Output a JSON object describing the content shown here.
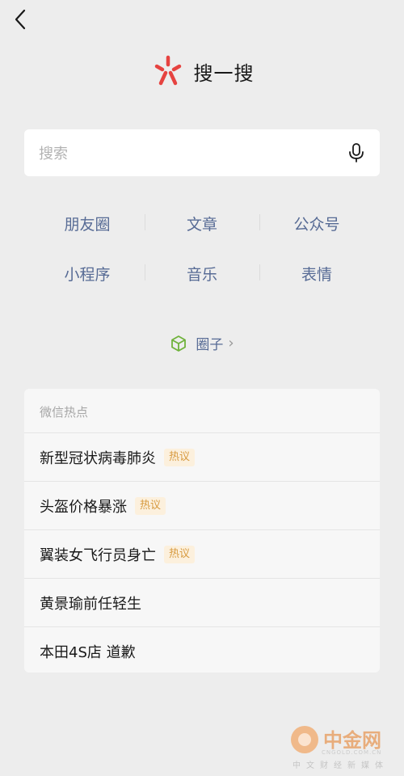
{
  "header": {
    "title": "搜一搜",
    "back_icon": "chevron-left-icon",
    "logo_icon": "search-spark-logo",
    "brand_color": "#e64340"
  },
  "search": {
    "placeholder": "搜索",
    "mic_icon": "microphone-icon"
  },
  "categories": [
    {
      "label": "朋友圈"
    },
    {
      "label": "文章"
    },
    {
      "label": "公众号"
    },
    {
      "label": "小程序"
    },
    {
      "label": "音乐"
    },
    {
      "label": "表情"
    }
  ],
  "circle": {
    "label": "圈子",
    "icon": "cube-icon",
    "chevron": "›"
  },
  "hot": {
    "title": "微信热点",
    "items": [
      {
        "text": "新型冠状病毒肺炎",
        "badge": "热议"
      },
      {
        "text": "头盔价格暴涨",
        "badge": "热议"
      },
      {
        "text": "翼装女飞行员身亡",
        "badge": "热议"
      },
      {
        "text": "黄景瑜前任轻生",
        "badge": ""
      },
      {
        "text": "本田4S店 道歉",
        "badge": ""
      }
    ]
  },
  "watermark": {
    "name": "中金网",
    "url": "CNGOLD.COM.CN",
    "tagline": "中文财经新媒体"
  },
  "colors": {
    "background": "#ededed",
    "link": "#576b95",
    "badge_text": "#d79a3f",
    "badge_bg": "#fcf0dd"
  }
}
